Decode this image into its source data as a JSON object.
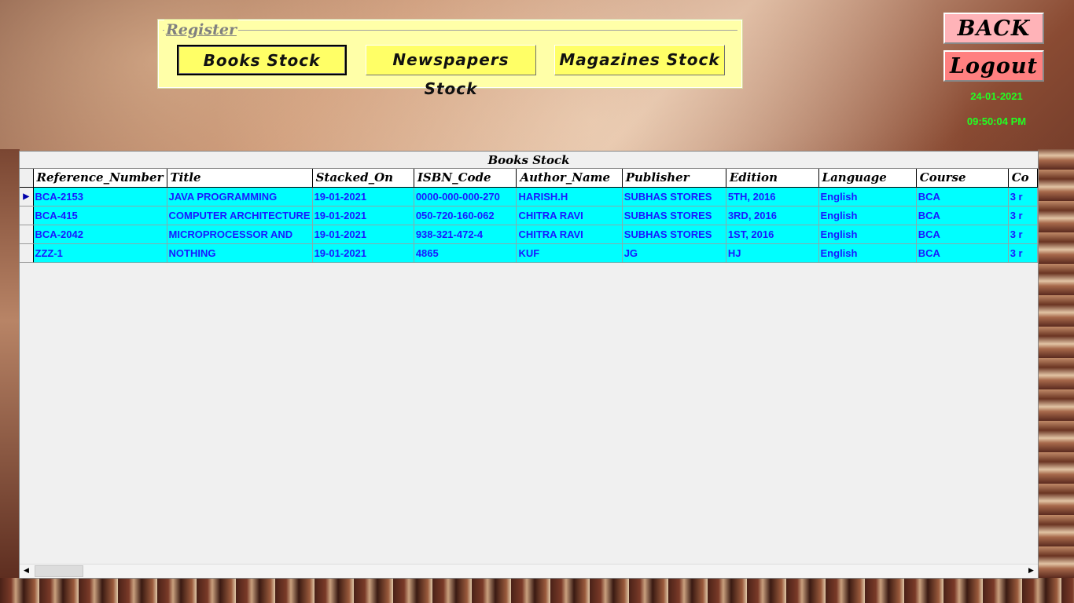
{
  "register": {
    "legend": "Register",
    "buttons": [
      "Books Stock",
      "Newspapers Stock",
      "Magazines Stock"
    ]
  },
  "side": {
    "back_label": "BACK",
    "logout_label": "Logout",
    "date": "24-01-2021",
    "time": "09:50:04 PM"
  },
  "grid": {
    "caption": "Books Stock",
    "columns": [
      "Reference_Number",
      "Title",
      "Stacked_On",
      "ISBN_Code",
      "Author_Name",
      "Publisher",
      "Edition",
      "Language",
      "Course",
      "Co"
    ],
    "rows": [
      [
        "BCA-2153",
        "JAVA PROGRAMMING",
        "19-01-2021",
        "0000-000-000-270",
        "HARISH.H",
        "SUBHAS STORES",
        "5TH, 2016",
        "English",
        "BCA",
        "3 r"
      ],
      [
        "BCA-415",
        "COMPUTER ARCHITECTURE",
        "19-01-2021",
        "050-720-160-062",
        "CHITRA RAVI",
        "SUBHAS STORES",
        "3RD, 2016",
        "English",
        "BCA",
        "3 r"
      ],
      [
        "BCA-2042",
        "MICROPROCESSOR AND",
        "19-01-2021",
        "938-321-472-4",
        "CHITRA RAVI",
        "SUBHAS STORES",
        "1ST, 2016",
        "English",
        "BCA",
        "3 r"
      ],
      [
        "ZZZ-1",
        "NOTHING",
        "19-01-2021",
        "4865",
        "KUF",
        "JG",
        "HJ",
        "English",
        "BCA",
        "3 r"
      ]
    ],
    "current_row_marker": "▶"
  },
  "colors": {
    "register_bg": "#ffffa8",
    "button_yellow": "#ffff66",
    "back_bg": "#ffb3b8",
    "logout_bg": "#ff8080",
    "clock_green": "#22ff22",
    "cell_bg": "#00ffff",
    "cell_text": "#1a1aff"
  }
}
